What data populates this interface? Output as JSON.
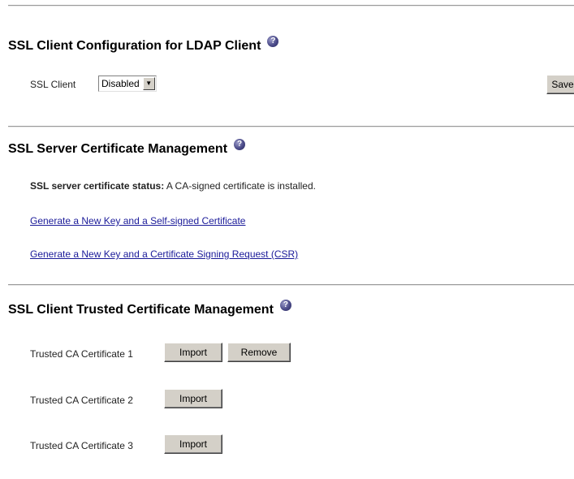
{
  "ldap_section": {
    "title": "SSL Client Configuration for LDAP Client",
    "help_icon": "help-icon",
    "ssl_client_label": "SSL Client",
    "ssl_client_value": "Disabled",
    "save_label": "Save"
  },
  "server_section": {
    "title": "SSL Server Certificate Management",
    "help_icon": "help-icon",
    "status_label": "SSL server certificate status:",
    "status_value": "A CA-signed certificate is installed.",
    "link_self_signed": "Generate a New Key and a Self-signed Certificate",
    "link_csr": "Generate a New Key and a Certificate Signing Request (CSR)"
  },
  "trusted_section": {
    "title": "SSL Client Trusted Certificate Management",
    "help_icon": "help-icon",
    "certificates": [
      {
        "label": "Trusted CA Certificate 1",
        "import_label": "Import",
        "remove_label": "Remove"
      },
      {
        "label": "Trusted CA Certificate 2",
        "import_label": "Import"
      },
      {
        "label": "Trusted CA Certificate 3",
        "import_label": "Import"
      }
    ]
  },
  "colors": {
    "link": "#1a1a99",
    "button_face": "#d4d0c8",
    "help_icon": "#4a4a88"
  }
}
